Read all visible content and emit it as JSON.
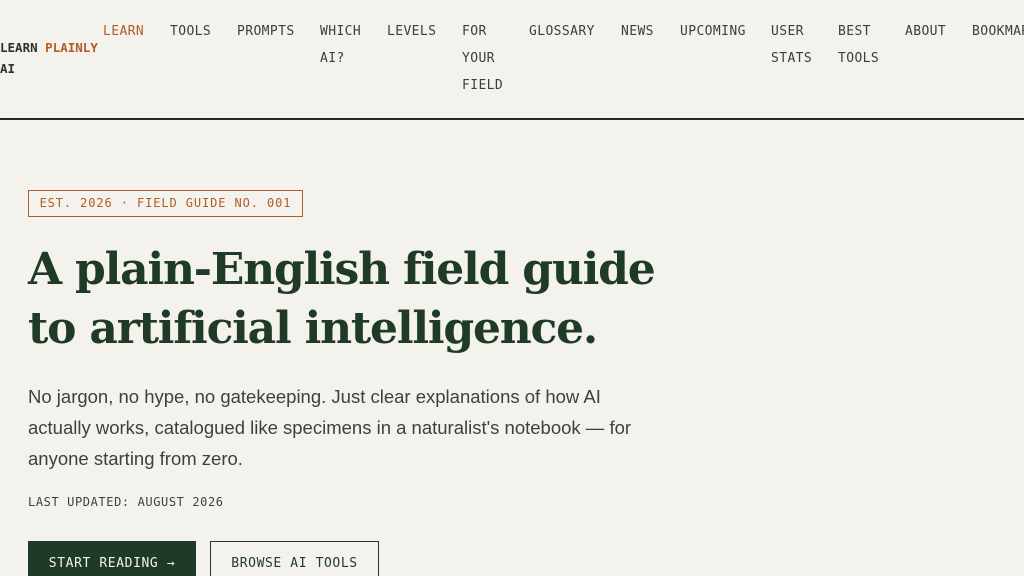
{
  "header": {
    "logo": {
      "word1": "LEARN",
      "word2": "PLAINLY",
      "word3": "AI"
    },
    "nav": [
      {
        "label": "LEARN",
        "active": true
      },
      {
        "label": "TOOLS"
      },
      {
        "label": "PROMPTS"
      },
      {
        "label": "WHICH AI?"
      },
      {
        "label": "LEVELS"
      },
      {
        "label": "FOR YOUR FIELD"
      },
      {
        "label": "GLOSSARY"
      },
      {
        "label": "NEWS"
      },
      {
        "label": "UPCOMING"
      },
      {
        "label": "USER STATS"
      },
      {
        "label": "BEST TOOLS"
      },
      {
        "label": "ABOUT"
      },
      {
        "label": "BOOKMARKS"
      }
    ]
  },
  "hero": {
    "badge": "EST. 2026 · FIELD GUIDE NO. 001",
    "title": "A plain-English field guide to artificial intelligence.",
    "lead": "No jargon, no hype, no gatekeeping. Just clear explanations of how AI actually works, catalogued like specimens in a naturalist's notebook — for anyone starting from zero.",
    "updated_label": "LAST UPDATED:",
    "updated_value": "August 2026",
    "primary_button": "START READING →",
    "secondary_button": "BROWSE AI TOOLS"
  },
  "colors": {
    "background": "#f3f2ec",
    "primary_green": "#1f3a26",
    "accent_orange": "#b05e26"
  }
}
